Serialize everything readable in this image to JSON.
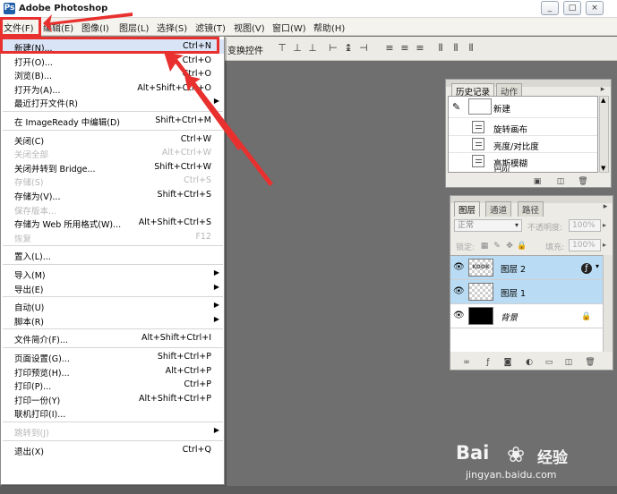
{
  "window": {
    "title": "Adobe Photoshop",
    "app_icon_glyph": "Ps",
    "controls": [
      "_",
      "□",
      "×"
    ]
  },
  "menubar": [
    "文件(F)",
    "编辑(E)",
    "图像(I)",
    "图层(L)",
    "选择(S)",
    "滤镜(T)",
    "视图(V)",
    "窗口(W)",
    "帮助(H)"
  ],
  "options_bar": {
    "label": "变换控件"
  },
  "file_menu": {
    "items": [
      {
        "label": "新建(N)...",
        "shortcut": "Ctrl+N",
        "highlight": true
      },
      {
        "label": "打开(O)...",
        "shortcut": "Ctrl+O"
      },
      {
        "label": "浏览(B)...",
        "shortcut": "Ctrl+O"
      },
      {
        "label": "打开为(A)...",
        "shortcut": "Alt+Shift+Ctrl+O"
      },
      {
        "label": "最近打开文件(R)",
        "submenu": true
      },
      {
        "sep": true
      },
      {
        "label": "在 ImageReady 中编辑(D)",
        "shortcut": "Shift+Ctrl+M"
      },
      {
        "sep": true
      },
      {
        "label": "关闭(C)",
        "shortcut": "Ctrl+W"
      },
      {
        "label": "关闭全部",
        "shortcut": "Alt+Ctrl+W",
        "disabled": true
      },
      {
        "label": "关闭并转到 Bridge...",
        "shortcut": "Shift+Ctrl+W"
      },
      {
        "label": "存储(S)",
        "shortcut": "Ctrl+S",
        "disabled": true
      },
      {
        "label": "存储为(V)...",
        "shortcut": "Shift+Ctrl+S"
      },
      {
        "label": "保存版本...",
        "disabled": true
      },
      {
        "label": "存储为 Web 所用格式(W)...",
        "shortcut": "Alt+Shift+Ctrl+S"
      },
      {
        "label": "恢复",
        "shortcut": "F12",
        "disabled": true
      },
      {
        "sep": true
      },
      {
        "label": "置入(L)..."
      },
      {
        "sep": true
      },
      {
        "label": "导入(M)",
        "submenu": true
      },
      {
        "label": "导出(E)",
        "submenu": true
      },
      {
        "sep": true
      },
      {
        "label": "自动(U)",
        "submenu": true
      },
      {
        "label": "脚本(R)",
        "submenu": true
      },
      {
        "sep": true
      },
      {
        "label": "文件简介(F)...",
        "shortcut": "Alt+Shift+Ctrl+I"
      },
      {
        "sep": true
      },
      {
        "label": "页面设置(G)...",
        "shortcut": "Shift+Ctrl+P"
      },
      {
        "label": "打印预览(H)...",
        "shortcut": "Alt+Ctrl+P"
      },
      {
        "label": "打印(P)...",
        "shortcut": "Ctrl+P"
      },
      {
        "label": "打印一份(Y)",
        "shortcut": "Alt+Shift+Ctrl+P"
      },
      {
        "label": "联机打印(I)..."
      },
      {
        "sep": true
      },
      {
        "label": "跳转到(J)",
        "submenu": true,
        "disabled": true
      },
      {
        "sep": true
      },
      {
        "label": "退出(X)",
        "shortcut": "Ctrl+Q"
      }
    ]
  },
  "history_panel": {
    "tabs": [
      "历史记录",
      "动作"
    ],
    "snapshot": "新建",
    "rows": [
      "旋转画布",
      "亮度/对比度",
      "高斯模糊",
      "色阶"
    ]
  },
  "layers_panel": {
    "tabs": [
      "图层",
      "通道",
      "路径"
    ],
    "blend_mode": "正常",
    "opacity_label": "不透明度:",
    "opacity_value": "100%",
    "lock_label": "锁定:",
    "fill_label": "填充:",
    "fill_value": "100%",
    "layers": [
      {
        "name": "图层 2",
        "selected": true,
        "thumb": "text"
      },
      {
        "name": "图层 1",
        "selected": true,
        "thumb": "checker"
      },
      {
        "name": "背景",
        "selected": false,
        "thumb": "black",
        "locked": true
      }
    ],
    "layer2_thumb_text": "KOOK"
  },
  "watermark": {
    "brand": "Bai",
    "brand_cn": "经验",
    "paw": "❀",
    "url": "jingyan.baidu.com"
  },
  "colors": {
    "highlight_red": "#e8312f",
    "selected_layer": "#b9dcf4",
    "workspace": "#6f6f6f"
  }
}
